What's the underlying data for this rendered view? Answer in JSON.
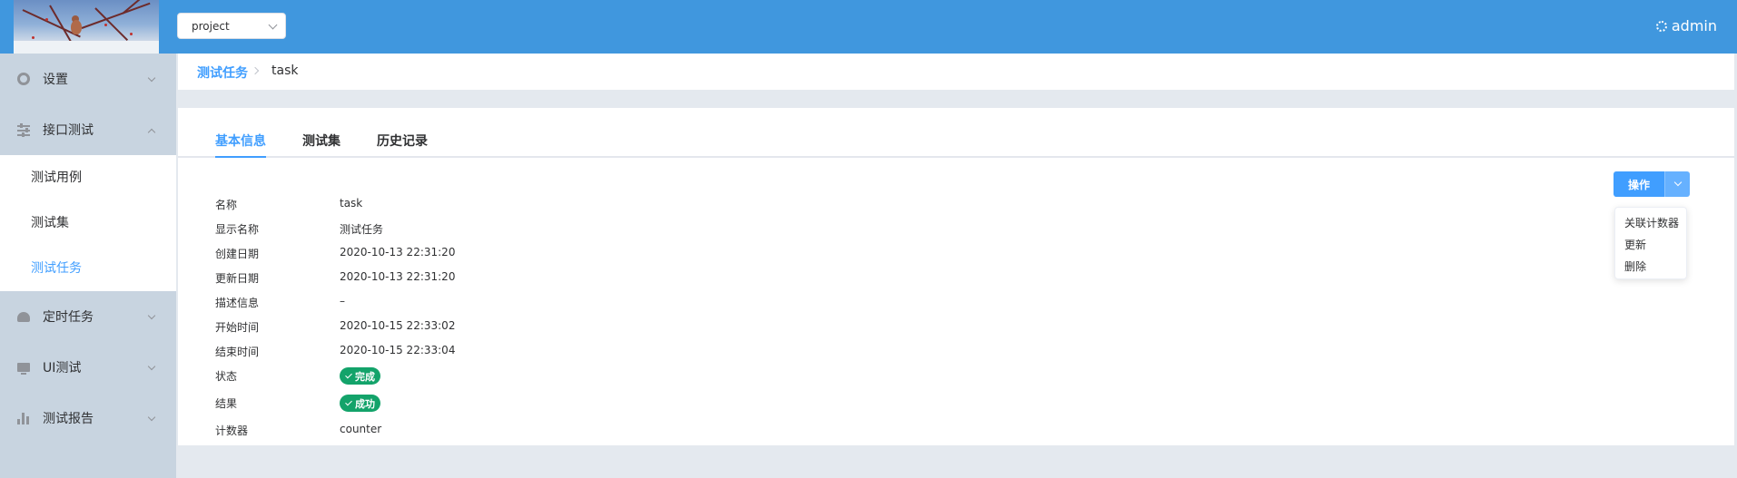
{
  "header": {
    "project_select": {
      "value": "project"
    },
    "user": {
      "name": "admin",
      "icon": "gear-icon"
    }
  },
  "sidebar": {
    "items": [
      {
        "label": "设置",
        "icon": "gear-icon",
        "expanded": false
      },
      {
        "label": "接口测试",
        "icon": "sliders-icon",
        "expanded": true,
        "children": [
          {
            "label": "测试用例",
            "active": false
          },
          {
            "label": "测试集",
            "active": false
          },
          {
            "label": "测试任务",
            "active": true
          }
        ]
      },
      {
        "label": "定时任务",
        "icon": "bell-icon",
        "expanded": false
      },
      {
        "label": "UI测试",
        "icon": "monitor-icon",
        "expanded": false
      },
      {
        "label": "测试报告",
        "icon": "bar-chart-icon",
        "expanded": false
      }
    ]
  },
  "breadcrumb": {
    "parent": "测试任务",
    "current": "task"
  },
  "tabs": [
    {
      "label": "基本信息",
      "active": true
    },
    {
      "label": "测试集",
      "active": false
    },
    {
      "label": "历史记录",
      "active": false
    }
  ],
  "details": {
    "name": {
      "label": "名称",
      "value": "task"
    },
    "display_name": {
      "label": "显示名称",
      "value": "测试任务"
    },
    "created": {
      "label": "创建日期",
      "value": "2020-10-13 22:31:20"
    },
    "updated": {
      "label": "更新日期",
      "value": "2020-10-13 22:31:20"
    },
    "description": {
      "label": "描述信息",
      "value": "–"
    },
    "start_time": {
      "label": "开始时间",
      "value": "2020-10-15 22:33:02"
    },
    "end_time": {
      "label": "结束时间",
      "value": "2020-10-15 22:33:04"
    },
    "status": {
      "label": "状态",
      "value": "完成"
    },
    "result": {
      "label": "结果",
      "value": "成功"
    },
    "counter": {
      "label": "计数器",
      "value": "counter"
    }
  },
  "actions": {
    "button_label": "操作",
    "menu": [
      "关联计数器",
      "更新",
      "删除"
    ]
  },
  "colors": {
    "header": "#4097de",
    "accent": "#409eff",
    "success": "#13a36a",
    "sidebar": "#c8d4e0"
  }
}
